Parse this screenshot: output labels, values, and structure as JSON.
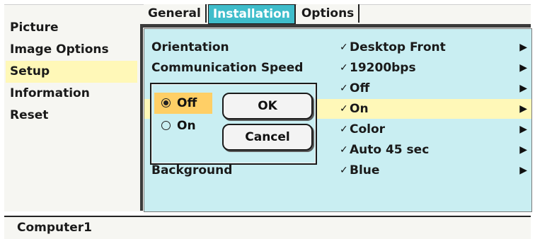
{
  "sidebar": {
    "items": [
      {
        "label": "Picture"
      },
      {
        "label": "Image Options"
      },
      {
        "label": "Setup"
      },
      {
        "label": "Information"
      },
      {
        "label": "Reset"
      }
    ],
    "selected_index": 2
  },
  "tabs": [
    {
      "label": "General"
    },
    {
      "label": "Installation"
    },
    {
      "label": "Options"
    }
  ],
  "active_tab": "Installation",
  "settings": {
    "rows": [
      {
        "label": "Orientation",
        "value": "Desktop Front"
      },
      {
        "label": "Communication Speed",
        "value": "19200bps"
      },
      {
        "label": "",
        "value": "Off"
      },
      {
        "label": "",
        "value": "On"
      },
      {
        "label": "",
        "value": "Color"
      },
      {
        "label": "",
        "value": "Auto 45 sec"
      },
      {
        "label": "Background",
        "value": "Blue"
      }
    ],
    "check_glyph": "✓",
    "arrow_glyph": "▶"
  },
  "dialog": {
    "options": [
      {
        "label": "Off",
        "selected": true
      },
      {
        "label": "On",
        "selected": false
      }
    ],
    "ok_label": "OK",
    "cancel_label": "Cancel"
  },
  "status_bar": {
    "source": "Computer1"
  },
  "colors": {
    "tab_active": "#3fbdcb",
    "panel_bg": "#c9eef2",
    "highlight": "#fff8b8",
    "selected_option": "#ffcf66"
  }
}
